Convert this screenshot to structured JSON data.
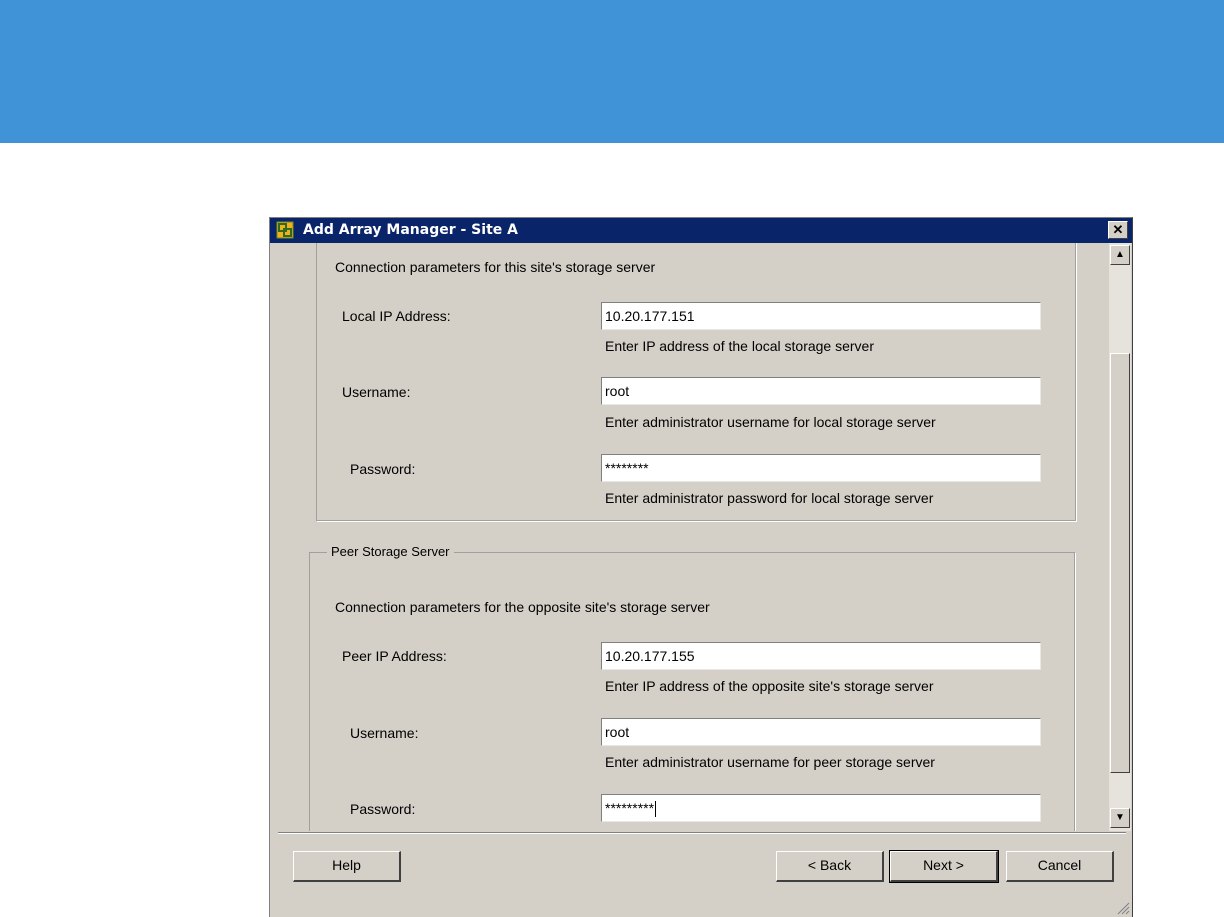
{
  "window": {
    "title": "Add Array Manager - Site A",
    "close_glyph": "✕"
  },
  "local_section": {
    "description": "Connection parameters for this site's storage server",
    "ip": {
      "label": "Local IP Address:",
      "value": "10.20.177.151",
      "hint": "Enter IP address of the local storage server"
    },
    "username": {
      "label": "Username:",
      "value": "root",
      "hint": "Enter administrator username for local storage server"
    },
    "password": {
      "label": "Password:",
      "value": "********",
      "hint": "Enter administrator password for local storage server"
    }
  },
  "peer_section": {
    "title": "Peer Storage Server",
    "description": "Connection parameters for the opposite site's storage server",
    "ip": {
      "label": "Peer IP Address:",
      "value": "10.20.177.155",
      "hint": "Enter IP address of the opposite site's storage server"
    },
    "username": {
      "label": "Username:",
      "value": "root",
      "hint": "Enter administrator username for peer storage server"
    },
    "password": {
      "label": "Password:",
      "value": "*********"
    }
  },
  "buttons": {
    "help": "Help",
    "back": "< Back",
    "next": "Next >",
    "cancel": "Cancel"
  },
  "scrollbar": {
    "up_glyph": "▲",
    "down_glyph": "▼"
  },
  "colors": {
    "banner": "#4193d7",
    "titlebar": "#0a246a",
    "dialog_bg": "#d4d0c8"
  }
}
